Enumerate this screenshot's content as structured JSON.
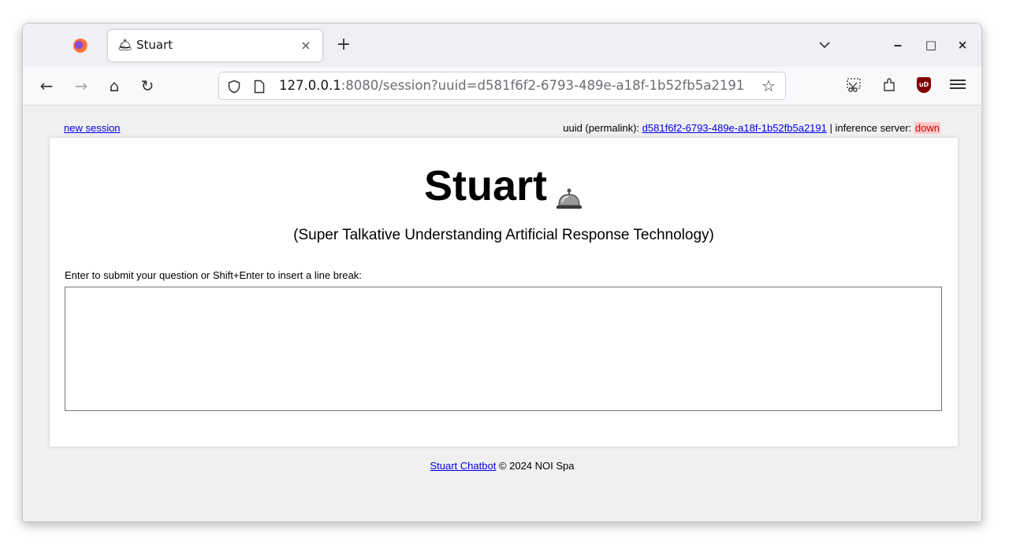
{
  "browser": {
    "tab": {
      "favicon": "bellhop-bell-icon",
      "title": "Stuart",
      "close_glyph": "×"
    },
    "new_tab_glyph": "+",
    "url": {
      "host": "127.0.0.1",
      "rest": ":8080/session?uuid=d581f6f2-6793-489e-a18f-1b52fb5a2191"
    },
    "window_controls": {
      "minimize": "‒",
      "maximize": "□",
      "close": "×"
    },
    "nav": {
      "back": "←",
      "forward": "→",
      "home": "⌂",
      "reload": "↻"
    },
    "bookmark_glyph": "☆",
    "ublock_label": "uD"
  },
  "page": {
    "new_session_link": "new session",
    "uuid_label": "uuid (permalink): ",
    "uuid_value": "d581f6f2-6793-489e-a18f-1b52fb5a2191",
    "server_label": " | inference server: ",
    "server_status": "down",
    "title": "Stuart",
    "subtitle": "(Super Talkative Understanding Artificial Response Technology)",
    "input_label": "Enter to submit your question or Shift+Enter to insert a line break:",
    "input_value": "",
    "footer_link": "Stuart Chatbot",
    "footer_text": " © 2024 NOI Spa"
  },
  "colors": {
    "link": "#0000ee",
    "status_down_bg": "#ffc8c8",
    "status_down_fg": "#d00000"
  }
}
